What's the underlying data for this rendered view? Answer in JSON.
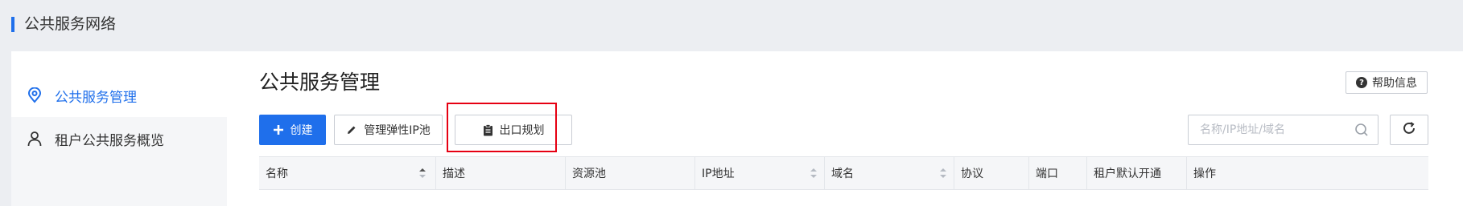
{
  "header": {
    "title": "公共服务网络"
  },
  "sidebar": {
    "items": [
      {
        "label": "公共服务管理",
        "icon": "location-signal-icon",
        "active": true
      },
      {
        "label": "租户公共服务概览",
        "icon": "user-icon",
        "active": false
      }
    ]
  },
  "main": {
    "title": "公共服务管理",
    "help_label": "帮助信息",
    "toolbar": {
      "create_label": "创建",
      "elastic_pool_label": "管理弹性IP池",
      "egress_plan_label": "出口规划"
    },
    "search": {
      "placeholder": "名称/IP地址/域名",
      "value": ""
    },
    "table": {
      "columns": [
        "名称",
        "描述",
        "资源池",
        "IP地址",
        "域名",
        "协议",
        "端口",
        "租户默认开通",
        "操作"
      ],
      "sortable": [
        "名称",
        "IP地址",
        "域名"
      ],
      "rows": []
    }
  },
  "colors": {
    "accent": "#1f6feb",
    "highlight": "#e60012"
  }
}
